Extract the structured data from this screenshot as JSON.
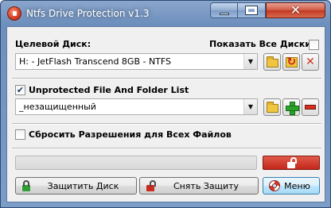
{
  "window": {
    "title": "Ntfs Drive Protection v1.3",
    "close_glyph": "✕"
  },
  "disk_section": {
    "label": "Целевой Диск:",
    "show_all_label": "Показать Все Диски",
    "show_all_checked": false,
    "selected_disk": "H: - JetFlash Transcend 8GB - NTFS"
  },
  "unprotected_section": {
    "label": "Unprotected File And Folder List",
    "checked": true,
    "selected_item": "_незащищенный"
  },
  "reset_section": {
    "label": "Сбросить Разрешения для Всех Файлов",
    "checked": false
  },
  "progress": {
    "value_percent": 0
  },
  "buttons": {
    "protect_label": "Защитить Диск",
    "unprotect_label": "Снять Защиту",
    "menu_label": "Меню"
  },
  "icons": {
    "app": "shield-icon",
    "browse": "folder-icon",
    "refresh": "refresh-icon",
    "tools": "tools-icon",
    "add": "plus-icon",
    "remove": "minus-icon",
    "unlock": "unlock-icon",
    "lock_green": "lock-icon",
    "lock_red": "unlock-icon",
    "menu": "lifebuoy-icon"
  },
  "colors": {
    "title_bar": "#7c9dc8",
    "close_button": "#c0391f",
    "red_button": "#c2271a",
    "menu_button": "#bee6fd"
  }
}
